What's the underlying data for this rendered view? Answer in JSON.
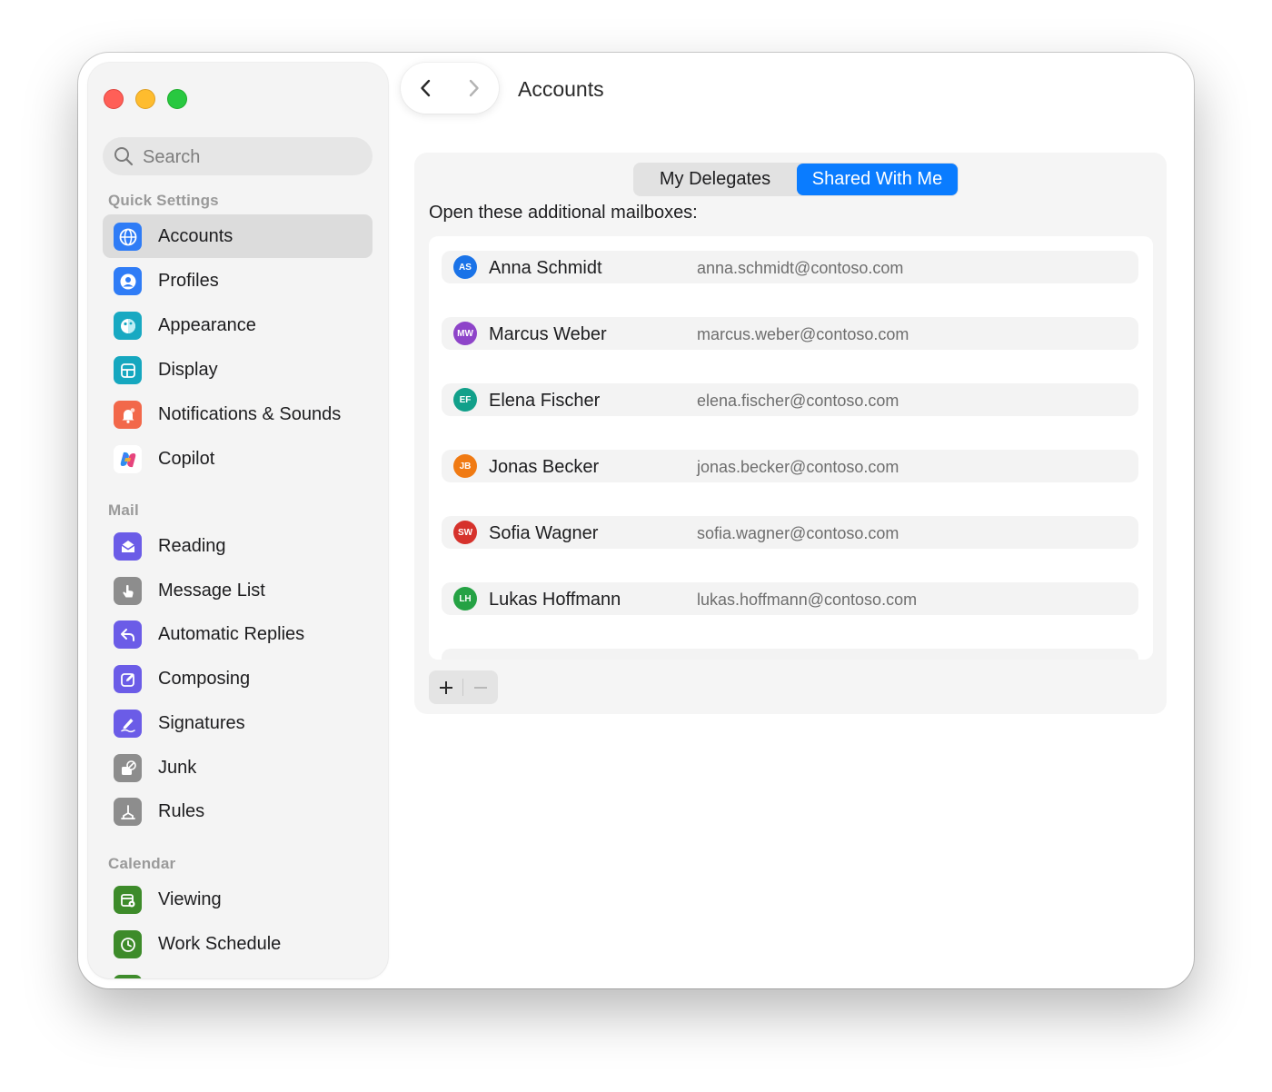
{
  "window": {
    "title": "Accounts"
  },
  "search": {
    "placeholder": "Search"
  },
  "sidebar": {
    "sections": [
      {
        "label": "Quick Settings",
        "items": [
          {
            "label": "Accounts",
            "icon": "globe-icon",
            "color": "#2f7cf6",
            "active": true
          },
          {
            "label": "Profiles",
            "icon": "profile-icon",
            "color": "#2f7cf6"
          },
          {
            "label": "Appearance",
            "icon": "appearance-icon",
            "color": "#18a9c2"
          },
          {
            "label": "Display",
            "icon": "display-icon",
            "color": "#15a7bf"
          },
          {
            "label": "Notifications & Sounds",
            "icon": "bell-icon",
            "color": "#f2684a"
          },
          {
            "label": "Copilot",
            "icon": "copilot-icon",
            "color": "#ffffff"
          }
        ]
      },
      {
        "label": "Mail",
        "items": [
          {
            "label": "Reading",
            "icon": "envelope-open-icon",
            "color": "#6b5ce7"
          },
          {
            "label": "Message List",
            "icon": "hand-pointer-icon",
            "color": "#8d8d8d"
          },
          {
            "label": "Automatic Replies",
            "icon": "reply-icon",
            "color": "#6b5ce7"
          },
          {
            "label": "Composing",
            "icon": "compose-icon",
            "color": "#6b5ce7"
          },
          {
            "label": "Signatures",
            "icon": "signature-icon",
            "color": "#6b5ce7"
          },
          {
            "label": "Junk",
            "icon": "junk-icon",
            "color": "#8d8d8d"
          },
          {
            "label": "Rules",
            "icon": "rules-icon",
            "color": "#8d8d8d"
          }
        ]
      },
      {
        "label": "Calendar",
        "items": [
          {
            "label": "Viewing",
            "icon": "calendar-settings-icon",
            "color": "#3d8b2a"
          },
          {
            "label": "Work Schedule",
            "icon": "clock-icon",
            "color": "#3d8b2a"
          }
        ]
      }
    ]
  },
  "tabs": {
    "my_delegates": "My Delegates",
    "shared_with_me": "Shared With Me",
    "selected": "Shared With Me"
  },
  "main": {
    "heading": "Open these additional mailboxes:",
    "mailboxes": [
      {
        "initials": "AS",
        "name": "Anna Schmidt",
        "email": "anna.schmidt@contoso.com",
        "color": "#1a73e8"
      },
      {
        "initials": "MW",
        "name": "Marcus Weber",
        "email": "marcus.weber@contoso.com",
        "color": "#8e44c9"
      },
      {
        "initials": "EF",
        "name": "Elena Fischer",
        "email": "elena.fischer@contoso.com",
        "color": "#12a08a"
      },
      {
        "initials": "JB",
        "name": "Jonas Becker",
        "email": "jonas.becker@contoso.com",
        "color": "#f07a13"
      },
      {
        "initials": "SW",
        "name": "Sofia Wagner",
        "email": "sofia.wagner@contoso.com",
        "color": "#d6322c"
      },
      {
        "initials": "LH",
        "name": "Lukas Hoffmann",
        "email": "lukas.hoffmann@contoso.com",
        "color": "#25a244"
      }
    ]
  },
  "controls": {
    "add_icon": "plus-icon",
    "remove_icon": "minus-icon"
  }
}
